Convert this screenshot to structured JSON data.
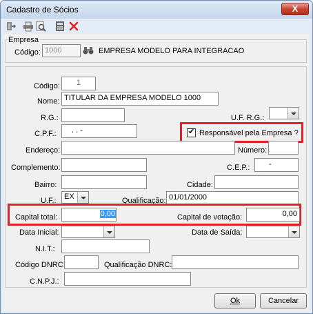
{
  "window": {
    "title": "Cadastro de Sócios",
    "close_glyph": "X"
  },
  "toolbar": {
    "icons": [
      "exit-icon",
      "print-icon",
      "preview-icon",
      "calculator-icon",
      "delete-icon"
    ]
  },
  "empresa": {
    "group_label": "Empresa",
    "codigo_label": "Código:",
    "codigo_value": "1000",
    "name": "EMPRESA MODELO PARA INTEGRACAO"
  },
  "socio": {
    "codigo_label": "Código:",
    "codigo_value": "1",
    "nome_label": "Nome:",
    "nome_value": "TITULAR DA EMPRESA MODELO 1000",
    "rg_label": "R.G.:",
    "rg_value": "",
    "uf_rg_label": "U.F. R.G.:",
    "uf_rg_value": "",
    "cpf_label": "C.P.F.:",
    "cpf_value": ".   .   -",
    "responsavel_label": "Responsável pela Empresa ?",
    "responsavel_checked": true,
    "endereco_label": "Endereço:",
    "endereco_value": "",
    "numero_label": "Número:",
    "numero_value": "",
    "complemento_label": "Complemento:",
    "complemento_value": "",
    "cep_label": "C.E.P.:",
    "cep_value": "-",
    "bairro_label": "Bairro:",
    "bairro_value": "",
    "cidade_label": "Cidade:",
    "cidade_value": "",
    "uf_label": "U.F.:",
    "uf_value": "EX",
    "qualificacao_label": "Qualificação:",
    "qualificacao_value": "01/01/2000",
    "capital_total_label": "Capital total:",
    "capital_total_value": "0,00",
    "capital_votacao_label": "Capital de votação:",
    "capital_votacao_value": "0,00",
    "data_inicial_label": "Data Inicial:",
    "data_inicial_value": "",
    "data_saida_label": "Data de Saída:",
    "data_saida_value": "",
    "nit_label": "N.I.T.:",
    "nit_value": "",
    "codigo_dnrc_label": "Código DNRC:",
    "codigo_dnrc_value": "",
    "qualificacao_dnrc_label": "Qualificação DNRC:",
    "qualificacao_dnrc_value": "",
    "cnpj_label": "C.N.P.J.:",
    "cnpj_value": ""
  },
  "buttons": {
    "ok": "Ok",
    "cancel": "Cancelar"
  },
  "colors": {
    "highlight": "#e0202a",
    "selection": "#3399ff"
  }
}
